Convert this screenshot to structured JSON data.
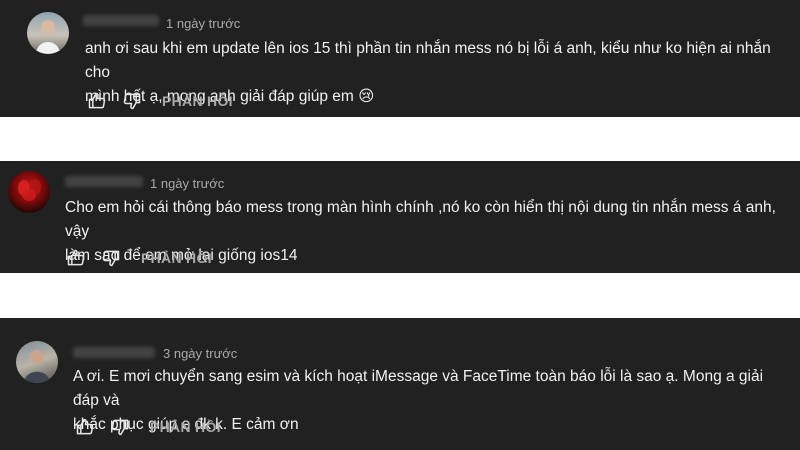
{
  "comments": [
    {
      "time": "1 ngày trước",
      "text_line1": "anh ơi sau khi em update lên ios 15 thì phần tin nhắn mess nó bị lỗi á anh, kiểu như ko hiện ai nhắn cho",
      "text_line2": "mình hết ạ, mong anh giải đáp giúp em 😢",
      "reply_label": "PHẢN HỒI",
      "avatar_icon": "person-outdoor-avatar"
    },
    {
      "time": "1 ngày trước",
      "text_line1": "Cho em hỏi cái thông báo mess trong màn hình chính ,nó ko còn hiển thị nội dung tin nhắn mess á anh, vậy",
      "text_line2": "làm sao để em mở lại giống ios14",
      "reply_label": "PHẢN HỒI",
      "avatar_icon": "red-flower-avatar"
    },
    {
      "time": "3 ngày trước",
      "text_line1": "A ơi. E mơi chuyển sang esim và kích hoạt iMessage và FaceTime toàn báo lỗi là sao ạ. Mong a giải đáp và",
      "text_line2": "khắc phục giúp e đk k. E cảm ơn",
      "reply_label": "PHẢN HỒI",
      "avatar_icon": "person-photo-avatar"
    }
  ],
  "colors": {
    "panel_bg": "#212121",
    "page_bg": "#ffffff",
    "text": "#f1f1f1",
    "secondary_text": "#aaaaaa"
  }
}
